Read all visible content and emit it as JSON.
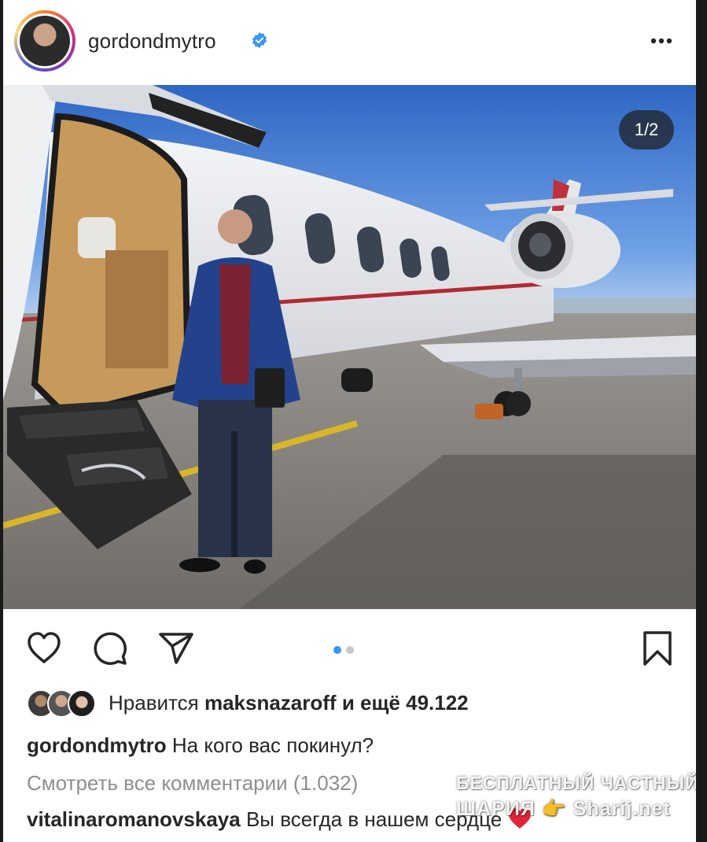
{
  "header": {
    "username": "gordondmytro",
    "counter": "1/2"
  },
  "likes": {
    "prefix": "Нравится",
    "user": "maksnazaroff",
    "suffix": "и ещё 49.122"
  },
  "caption": {
    "user": "gordondmytro",
    "text": "На кого вас покинул?"
  },
  "view_all_comments": "Смотреть все комментарии (1.032)",
  "comment": {
    "user": "vitalinaromanovskaya",
    "text": "Вы всегда в нашем сердце"
  },
  "watermark": {
    "line1": "БЕСПЛАТНЫЙ ЧАСТНЫЙ",
    "line2": "ШАРИЯ 👉 Sharij.net"
  },
  "colors": {
    "verified": "#3897f0",
    "active_dot": "#3897f0",
    "inactive_dot": "#c7c7c7",
    "text": "#262626",
    "muted": "#8e8e8e"
  },
  "icons": [
    "more-icon",
    "heart-icon",
    "comment-icon",
    "share-icon",
    "bookmark-icon",
    "verified-badge-icon"
  ],
  "carousel": {
    "current": 1,
    "total": 2
  }
}
